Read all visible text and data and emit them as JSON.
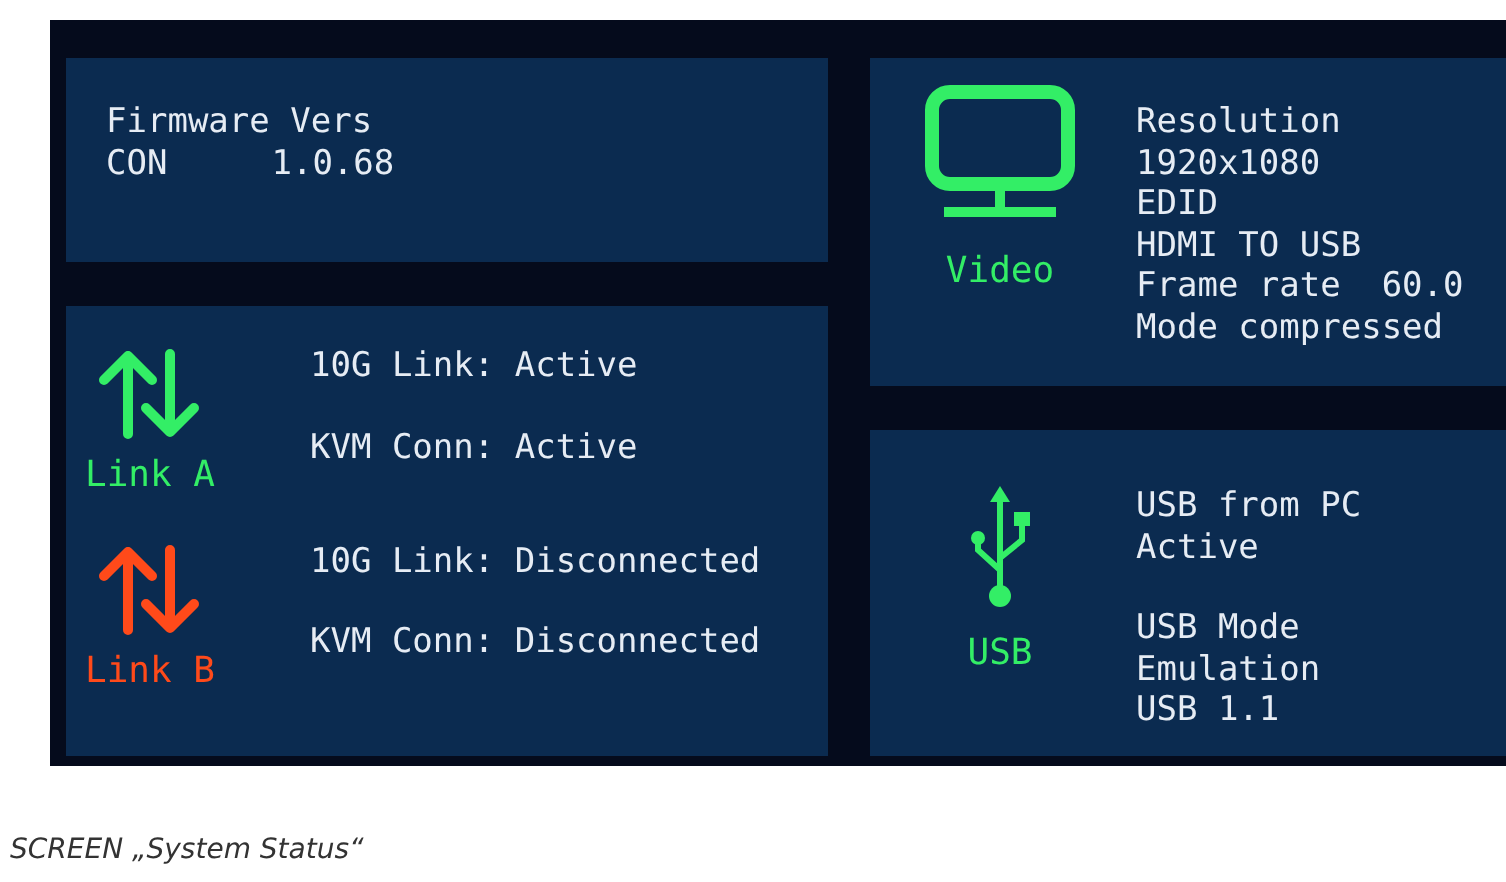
{
  "firmware": {
    "title": "Firmware Vers",
    "rows": [
      {
        "name": "CON",
        "value": "1.0.68"
      }
    ]
  },
  "links": [
    {
      "label": "Link A",
      "color": "#33ee66",
      "lines": [
        "10G Link: Active",
        "KVM Conn: Active"
      ]
    },
    {
      "label": "Link B",
      "color": "#ff4a1a",
      "lines": [
        "10G Link: Disconnected",
        "KVM Conn: Disconnected"
      ]
    }
  ],
  "video": {
    "label": "Video",
    "lines": [
      "Resolution",
      "1920x1080",
      "EDID",
      "HDMI TO USB",
      "Frame rate  60.0",
      "Mode compressed"
    ]
  },
  "usb": {
    "label": "USB",
    "groups": [
      [
        "USB from PC",
        "Active"
      ],
      [
        "USB Mode",
        "Emulation",
        "USB 1.1"
      ]
    ]
  },
  "caption": "SCREEN „System Status“"
}
